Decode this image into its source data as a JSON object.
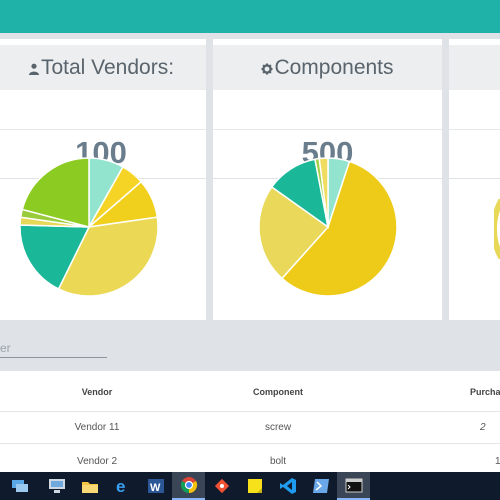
{
  "cards": [
    {
      "title": "Total Vendors:",
      "icon": "user-icon",
      "value": "100",
      "chart_data": {
        "type": "pie",
        "values": [
          9,
          6,
          10,
          38,
          20,
          2,
          2,
          23
        ],
        "colors": [
          "#93e4cf",
          "#f5d425",
          "#f0cf1d",
          "#ebd956",
          "#1ab799",
          "#e8d858",
          "#9acb3a",
          "#8ccb21"
        ]
      }
    },
    {
      "title": "Components",
      "icon": "gear-icon",
      "value": "500",
      "chart_data": {
        "type": "pie",
        "values": [
          5,
          56,
          23,
          12,
          1,
          2
        ],
        "colors": [
          "#93e4cf",
          "#edcb18",
          "#e9d85a",
          "#1ab799",
          "#a5d04a",
          "#f0dc60"
        ]
      }
    }
  ],
  "filter": {
    "placeholder": "er"
  },
  "table": {
    "columns": [
      "Vendor",
      "Component",
      "Purcha"
    ],
    "rows": [
      [
        "Vendor 11",
        "screw",
        "2"
      ],
      [
        "Vendor 2",
        "bolt",
        "1"
      ]
    ]
  },
  "taskbar": {
    "items": [
      "network-icon",
      "computer-icon",
      "file-explorer-icon",
      "edge-icon",
      "word-icon",
      "chrome-icon",
      "git-icon",
      "sticky-notes-icon",
      "vscode-icon",
      "powershell-icon",
      "terminal-icon"
    ]
  }
}
